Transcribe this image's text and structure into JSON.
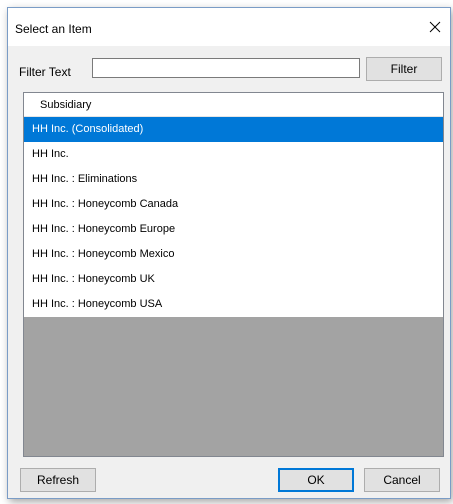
{
  "dialog": {
    "title": "Select an Item"
  },
  "filter": {
    "label": "Filter Text",
    "value": "",
    "placeholder": "",
    "button_label": "Filter"
  },
  "list": {
    "column_header": "Subsidiary",
    "selected_index": 0,
    "items": [
      "HH Inc. (Consolidated)",
      "HH Inc.",
      "HH Inc. : Eliminations",
      "HH Inc. : Honeycomb Canada",
      "HH Inc. : Honeycomb Europe",
      "HH Inc. : Honeycomb Mexico",
      "HH Inc. : Honeycomb UK",
      "HH Inc. : Honeycomb USA"
    ]
  },
  "footer": {
    "refresh_label": "Refresh",
    "ok_label": "OK",
    "cancel_label": "Cancel"
  },
  "colors": {
    "selection": "#0078d7",
    "empty_list_area": "#a3a3a3",
    "dialog_background": "#f0f0f0"
  },
  "icons": {
    "close": "close-icon"
  }
}
